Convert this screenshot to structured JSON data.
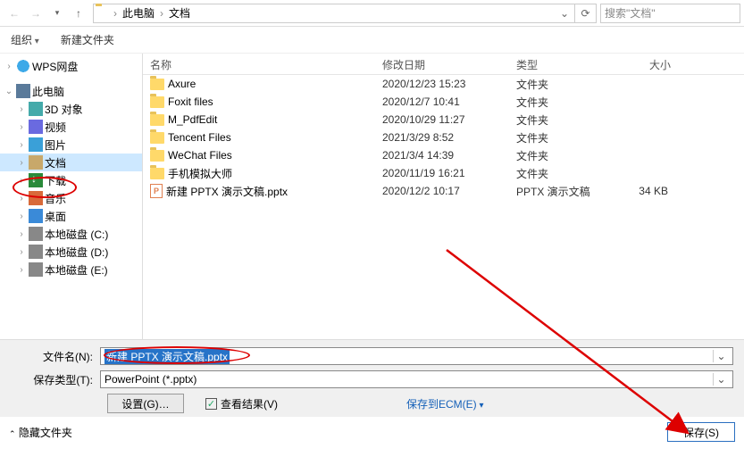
{
  "breadcrumb": {
    "root": "此电脑",
    "current": "文档"
  },
  "search": {
    "placeholder": "搜索\"文档\""
  },
  "toolbar": {
    "organize": "组织",
    "newfolder": "新建文件夹"
  },
  "sidebar": {
    "wps": "WPS网盘",
    "pc": "此电脑",
    "items": [
      {
        "label": "3D 对象"
      },
      {
        "label": "视频"
      },
      {
        "label": "图片"
      },
      {
        "label": "文档"
      },
      {
        "label": "下载"
      },
      {
        "label": "音乐"
      },
      {
        "label": "桌面"
      },
      {
        "label": "本地磁盘 (C:)"
      },
      {
        "label": "本地磁盘 (D:)"
      },
      {
        "label": "本地磁盘 (E:)"
      }
    ]
  },
  "columns": {
    "name": "名称",
    "date": "修改日期",
    "type": "类型",
    "size": "大小"
  },
  "files": [
    {
      "name": "Axure",
      "date": "2020/12/23 15:23",
      "type": "文件夹",
      "size": "",
      "kind": "folder"
    },
    {
      "name": "Foxit files",
      "date": "2020/12/7 10:41",
      "type": "文件夹",
      "size": "",
      "kind": "folder"
    },
    {
      "name": "M_PdfEdit",
      "date": "2020/10/29 11:27",
      "type": "文件夹",
      "size": "",
      "kind": "folder"
    },
    {
      "name": "Tencent Files",
      "date": "2021/3/29 8:52",
      "type": "文件夹",
      "size": "",
      "kind": "folder"
    },
    {
      "name": "WeChat Files",
      "date": "2021/3/4 14:39",
      "type": "文件夹",
      "size": "",
      "kind": "folder"
    },
    {
      "name": "手机模拟大师",
      "date": "2020/11/19 16:21",
      "type": "文件夹",
      "size": "",
      "kind": "folder"
    },
    {
      "name": "新建 PPTX 演示文稿.pptx",
      "date": "2020/12/2 10:17",
      "type": "PPTX 演示文稿",
      "size": "34 KB",
      "kind": "pptx"
    }
  ],
  "form": {
    "filename_label": "文件名(N):",
    "filename_value": "新建 PPTX 演示文稿.pptx",
    "filetype_label": "保存类型(T):",
    "filetype_value": "PowerPoint (*.pptx)",
    "settings_btn": "设置(G)…",
    "view_result": "查看结果(V)",
    "save_ecm": "保存到ECM(E)",
    "hide_folders": "隐藏文件夹",
    "save_btn": "保存(S)"
  }
}
